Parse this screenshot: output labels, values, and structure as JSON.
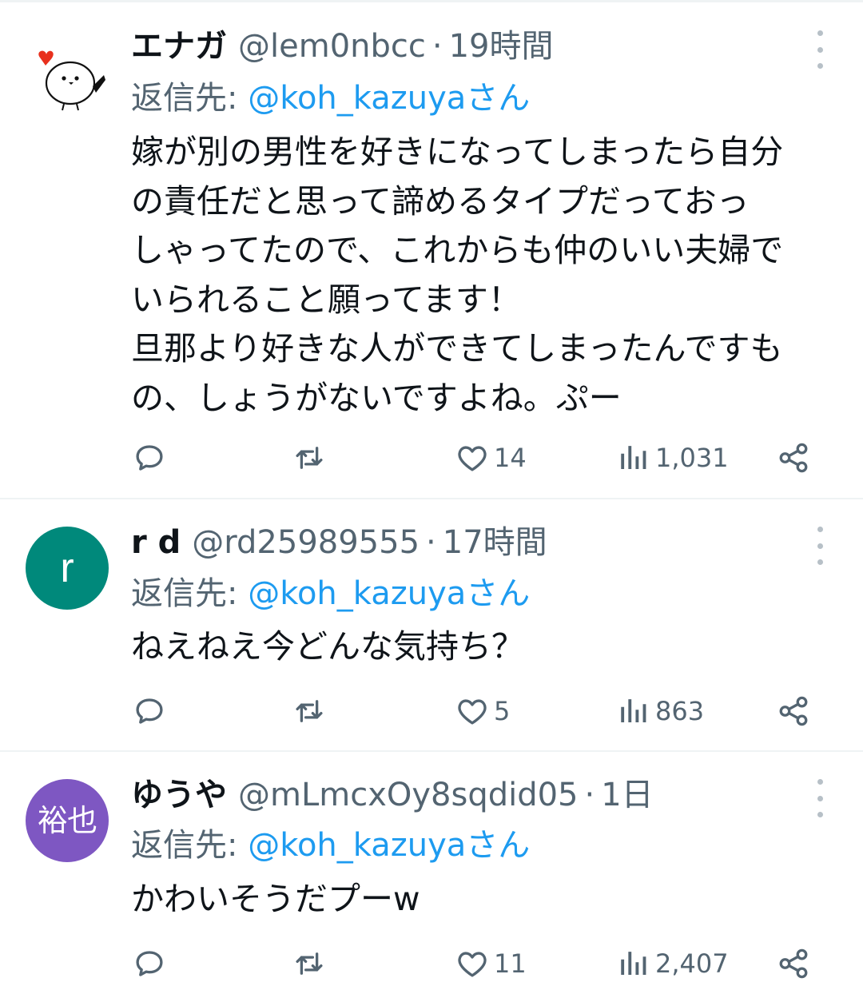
{
  "tweets": [
    {
      "name": "エナガ",
      "handle": "@lem0nbcc",
      "separator": "·",
      "time": "19時間",
      "reply_label": "返信先:",
      "reply_handle": "@koh_kazuyaさん",
      "body_lines": [
        "嫁が別の男性を好きになってしまったら自分",
        "の責任だと思って諦めるタイプだっておっ",
        "しゃってたので、これからも仲のいい夫婦で",
        "いられること願ってます！",
        "旦那より好きな人ができてしまったんですも",
        "の、しょうがないですよね。ぷー"
      ],
      "likes": "14",
      "views": "1,031",
      "avatar": {
        "type": "image",
        "icon": "long-tailed-tit-bird-icon",
        "background": "#ffffff"
      }
    },
    {
      "name": "r d",
      "handle": "@rd25989555",
      "separator": "·",
      "time": "17時間",
      "reply_label": "返信先:",
      "reply_handle": "@koh_kazuyaさん",
      "body_lines": [
        "ねえねえ今どんな気持ち？"
      ],
      "likes": "5",
      "views": "863",
      "avatar": {
        "type": "text",
        "text": "r",
        "background": "#00897b"
      }
    },
    {
      "name": "ゆうや",
      "handle": "@mLmcxOy8sqdid05",
      "separator": "·",
      "time": "1日",
      "reply_label": "返信先:",
      "reply_handle": "@koh_kazuyaさん",
      "body_lines": [
        "かわいそうだプーw"
      ],
      "likes": "11",
      "views": "2,407",
      "avatar": {
        "type": "text",
        "text": "裕也",
        "background": "#7e57c2"
      }
    }
  ],
  "colors": {
    "text": "#0f1419",
    "secondary": "#536471",
    "link": "#1d9bf0",
    "divider": "#eff3f4"
  },
  "icons": [
    "reply-icon",
    "retweet-icon",
    "like-icon",
    "views-icon",
    "share-icon",
    "more-icon"
  ]
}
